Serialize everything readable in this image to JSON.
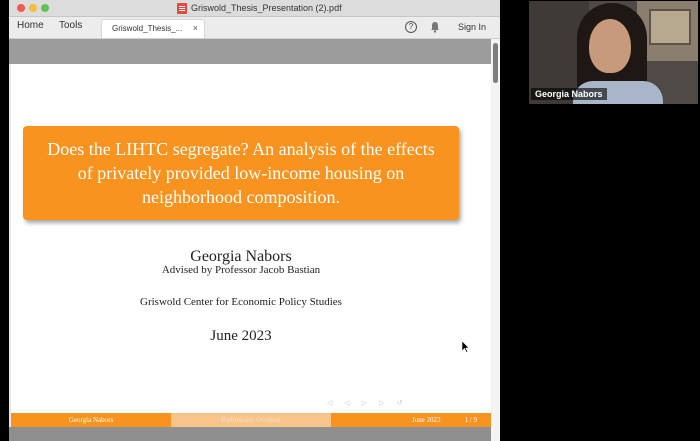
{
  "window": {
    "title": "Griswold_Thesis_Presentation (2).pdf"
  },
  "toolbar": {
    "home_label": "Home",
    "tools_label": "Tools",
    "tab_label": "Griswold_Thesis_...",
    "tab_close": "×",
    "help_glyph": "?",
    "signin_label": "Sign In"
  },
  "slide": {
    "title": "Does the LIHTC segregate? An analysis of the effects of privately provided low-income housing on neighborhood composition.",
    "author": "Georgia Nabors",
    "advisor": "Advised by Professor Jacob Bastian",
    "institute": "Griswold Center for Economic Policy Studies",
    "date": "June 2023",
    "footer": {
      "author": "Georgia Nabors",
      "short_title": "Preliminary Overleaf",
      "date": "June 2023",
      "page": "1 / 9"
    }
  },
  "video": {
    "participant_name": "Georgia Nabors"
  },
  "colors": {
    "accent": "#f7931e",
    "accent_light": "#f9c48a"
  },
  "icons": [
    "pdf-icon",
    "help-icon",
    "bell-icon",
    "close-icon",
    "cursor-icon"
  ]
}
